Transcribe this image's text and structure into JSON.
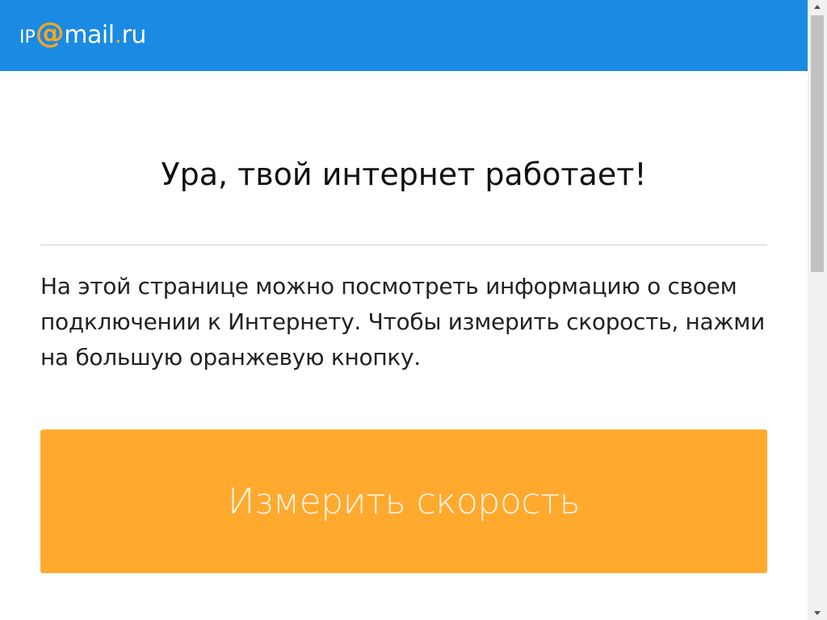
{
  "header": {
    "logo": {
      "ip": "IP",
      "at": "@",
      "mail": "mail",
      "dot": ".",
      "ru": "ru"
    },
    "colors": {
      "background": "#1a8ae3",
      "accent": "#f5a623"
    }
  },
  "main": {
    "headline": "Ура, твой интернет работает!",
    "description": "На этой странице можно посмотреть информацию о своем подключении к Интернету. Чтобы измерить скорость, нажми на большую оранжевую кнопку.",
    "measure_button_label": "Измерить скорость",
    "button_color": "#ffa92e"
  },
  "scrollbar": {
    "up_icon": "triangle-up",
    "down_icon": "triangle-down"
  }
}
